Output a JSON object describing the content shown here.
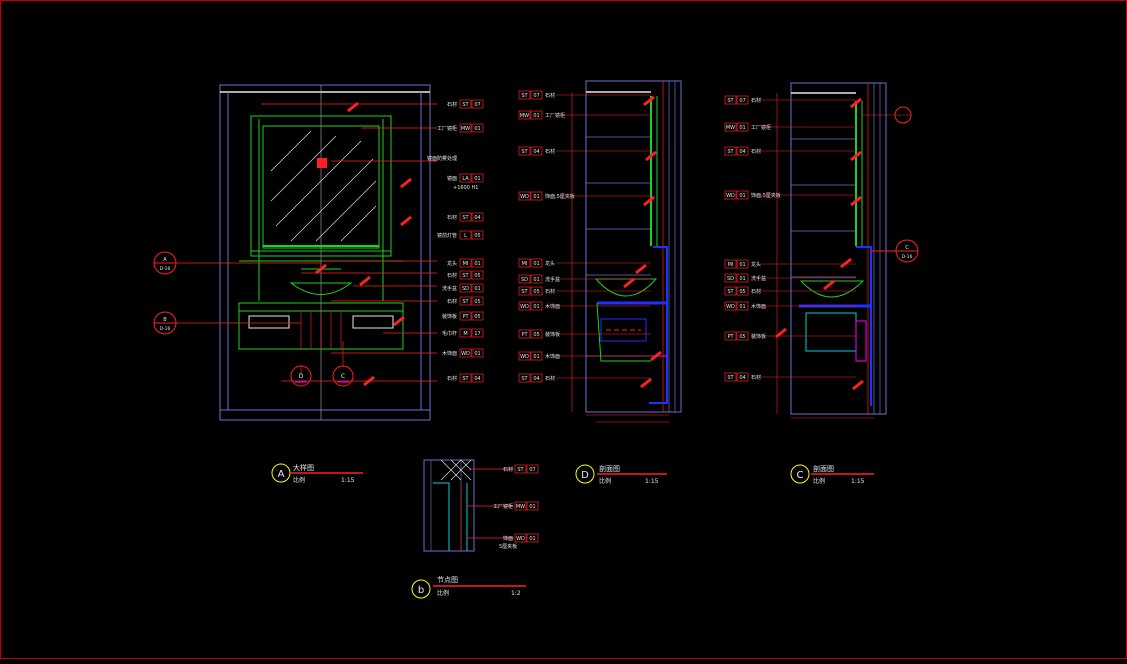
{
  "titles": {
    "a": {
      "letter": "A",
      "name": "大样图",
      "scale_label": "比例",
      "scale": "1:15"
    },
    "d": {
      "letter": "D",
      "name": "剖面图",
      "scale_label": "比例",
      "scale": "1:15"
    },
    "c": {
      "letter": "C",
      "name": "剖面图",
      "scale_label": "比例",
      "scale": "1:15"
    },
    "b": {
      "letter": "b",
      "name": "节点图",
      "scale_label": "比例",
      "scale": "1:2"
    }
  },
  "elevation_a": {
    "tags": [
      {
        "text": "石材",
        "codes": [
          "ST",
          "07"
        ]
      },
      {
        "text": "工厂镜柜",
        "codes": [
          "MW",
          "01"
        ]
      },
      {
        "text": "镜面防雾处理"
      },
      {
        "text": "镜面",
        "codes": [
          "LA",
          "01"
        ],
        "note": "+1600 H1"
      },
      {
        "text": "石材",
        "codes": [
          "ST",
          "04"
        ]
      },
      {
        "text": "镜前灯管",
        "codes": [
          "L",
          "05"
        ]
      },
      {
        "text": "龙头",
        "codes": [
          "MI",
          "01"
        ]
      },
      {
        "text": "石材",
        "codes": [
          "ST",
          "05"
        ]
      },
      {
        "text": "洗手盆",
        "codes": [
          "SD",
          "01"
        ]
      },
      {
        "text": "石材",
        "codes": [
          "ST",
          "05"
        ]
      },
      {
        "text": "装饰板",
        "codes": [
          "PT",
          "05"
        ]
      },
      {
        "text": "毛巾杆",
        "codes": [
          "M",
          "17"
        ]
      },
      {
        "text": "木饰面",
        "codes": [
          "WD",
          "01"
        ]
      },
      {
        "text": "石材",
        "codes": [
          "ST",
          "04"
        ]
      }
    ],
    "callouts": [
      {
        "letter": "A",
        "ref": "D-16"
      },
      {
        "letter": "B",
        "ref": "D-16"
      },
      {
        "letter": "D",
        "ref": ""
      },
      {
        "letter": "C",
        "ref": ""
      }
    ]
  },
  "section_d": {
    "tags": [
      {
        "codes": [
          "ST",
          "07"
        ],
        "text": "石材"
      },
      {
        "codes": [
          "MW",
          "01"
        ],
        "text": "工厂镜柜"
      },
      {
        "codes": [
          "ST",
          "04"
        ],
        "text": "石材"
      },
      {
        "codes": [
          "WD",
          "01"
        ],
        "text": "饰面,5厘夹板"
      },
      {
        "codes": [
          "MI",
          "01"
        ],
        "text": "龙头"
      },
      {
        "codes": [
          "SD",
          "01"
        ],
        "text": "洗手盆"
      },
      {
        "codes": [
          "ST",
          "05"
        ],
        "text": "石材"
      },
      {
        "codes": [
          "WD",
          "01"
        ],
        "text": "木饰面"
      },
      {
        "codes": [
          "PT",
          "05"
        ],
        "text": "装饰板"
      },
      {
        "codes": [
          "WD",
          "01"
        ],
        "text": "木饰面"
      },
      {
        "codes": [
          "ST",
          "04"
        ],
        "text": "石材"
      }
    ]
  },
  "section_c": {
    "tags": [
      {
        "codes": [
          "ST",
          "07"
        ],
        "text": "石材"
      },
      {
        "codes": [
          "MW",
          "01"
        ],
        "text": "工厂镜柜"
      },
      {
        "codes": [
          "ST",
          "04"
        ],
        "text": "石材"
      },
      {
        "codes": [
          "WD",
          "01"
        ],
        "text": "饰面,5厘夹板"
      },
      {
        "codes": [
          "MI",
          "01"
        ],
        "text": "龙头"
      },
      {
        "codes": [
          "SD",
          "01"
        ],
        "text": "洗手盆"
      },
      {
        "codes": [
          "ST",
          "05"
        ],
        "text": "石材"
      },
      {
        "codes": [
          "WD",
          "01"
        ],
        "text": "木饰面"
      },
      {
        "codes": [
          "PT",
          "05"
        ],
        "text": "装饰板"
      },
      {
        "codes": [
          "ST",
          "04"
        ],
        "text": "石材"
      }
    ],
    "callouts": [
      {
        "letter": "C",
        "ref": "D-16"
      }
    ]
  },
  "detail_b": {
    "tags": [
      {
        "text": "石材",
        "codes": [
          "ST",
          "07"
        ]
      },
      {
        "text": "工厂镜柜",
        "codes": [
          "MW",
          "01"
        ]
      },
      {
        "text": "饰面",
        "codes": [
          "WD",
          "01"
        ],
        "note": "5厘夹板"
      }
    ]
  },
  "colors": {
    "background": "#000000",
    "border": "#c00000",
    "outline": "#6f6fd0",
    "green": "#1fd01f",
    "red": "#ff2020",
    "white": "#e8e8e8",
    "cyan": "#00d0d0",
    "yellow": "#ffff00",
    "blue": "#2030ff",
    "magenta": "#ff00ff",
    "label_fill": "#c00000"
  }
}
